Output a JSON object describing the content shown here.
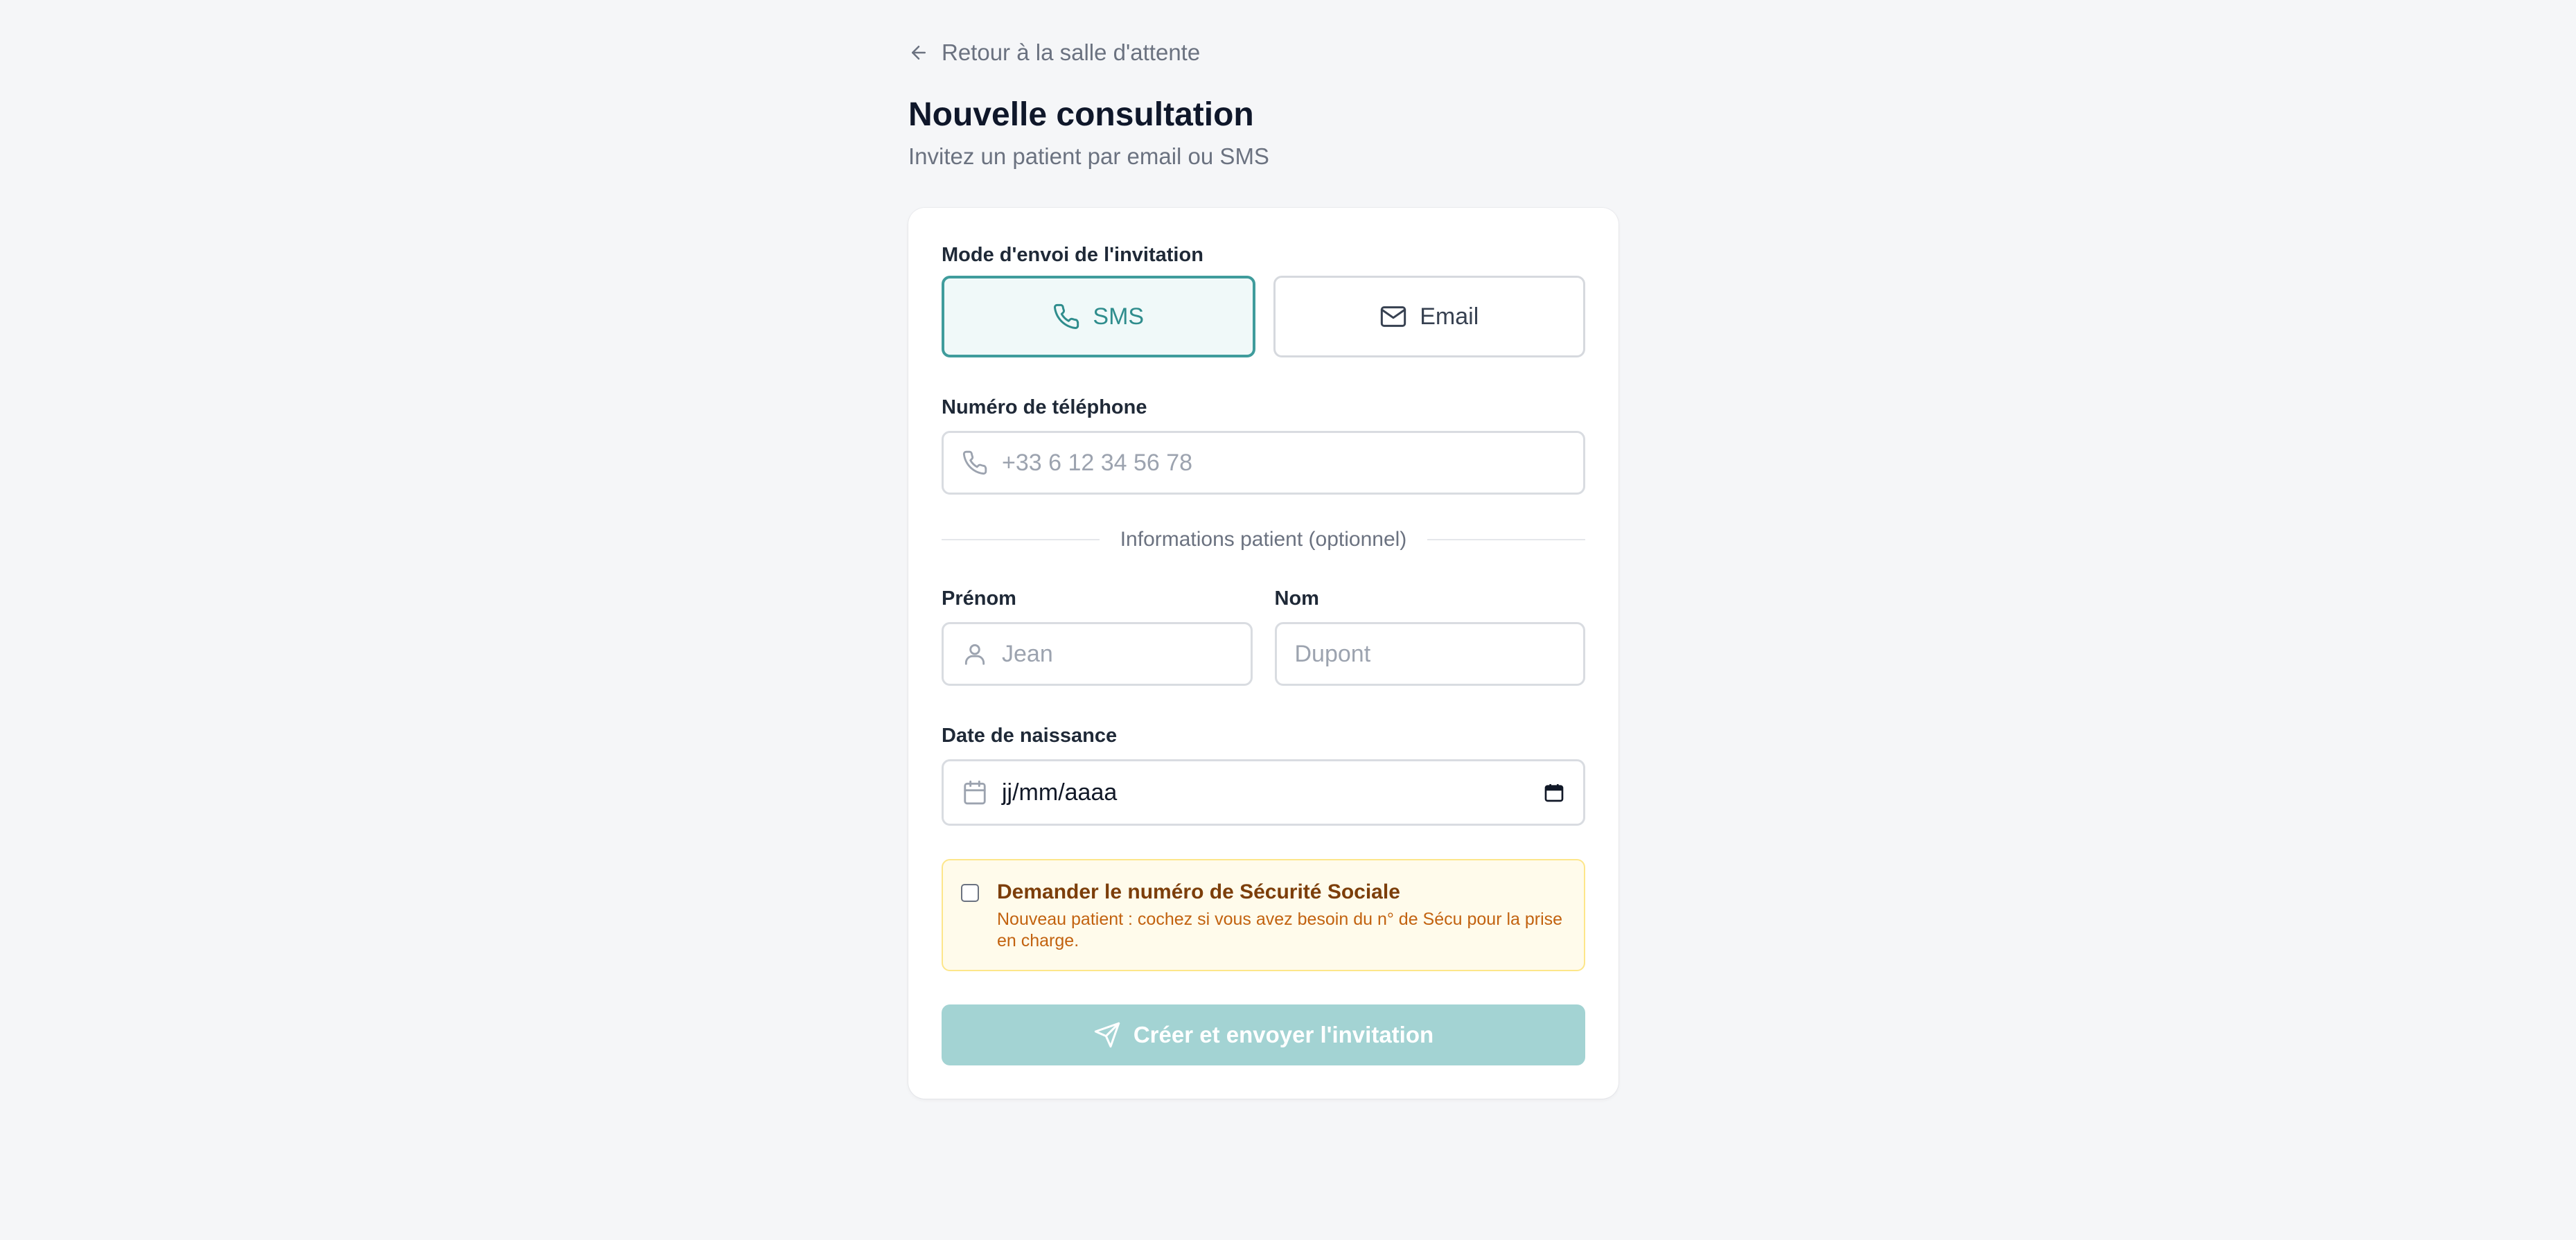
{
  "header": {
    "back_label": "Retour à la salle d'attente",
    "title": "Nouvelle consultation",
    "subtitle": "Invitez un patient par email ou SMS"
  },
  "form": {
    "mode_label": "Mode d'envoi de l'invitation",
    "modes": [
      {
        "label": "SMS",
        "icon": "phone-icon",
        "selected": true
      },
      {
        "label": "Email",
        "icon": "mail-icon",
        "selected": false
      }
    ],
    "phone_label": "Numéro de téléphone",
    "phone_placeholder": "+33 6 12 34 56 78",
    "patient_section_label": "Informations patient (optionnel)",
    "first_name_label": "Prénom",
    "first_name_placeholder": "Jean",
    "last_name_label": "Nom",
    "last_name_placeholder": "Dupont",
    "birthdate_label": "Date de naissance",
    "birthdate_placeholder": "jj/mm/aaaa",
    "ssn_checkbox_label": "Demander le numéro de Sécurité Sociale",
    "ssn_checkbox_help": "Nouveau patient : cochez si vous avez besoin du n° de Sécu pour la prise en charge.",
    "ssn_checked": false,
    "submit_label": "Créer et envoyer l'invitation"
  },
  "colors": {
    "accent": "#3f9c9c",
    "submit_disabled": "#a3d3d3",
    "notice_bg": "#fffbeb"
  }
}
